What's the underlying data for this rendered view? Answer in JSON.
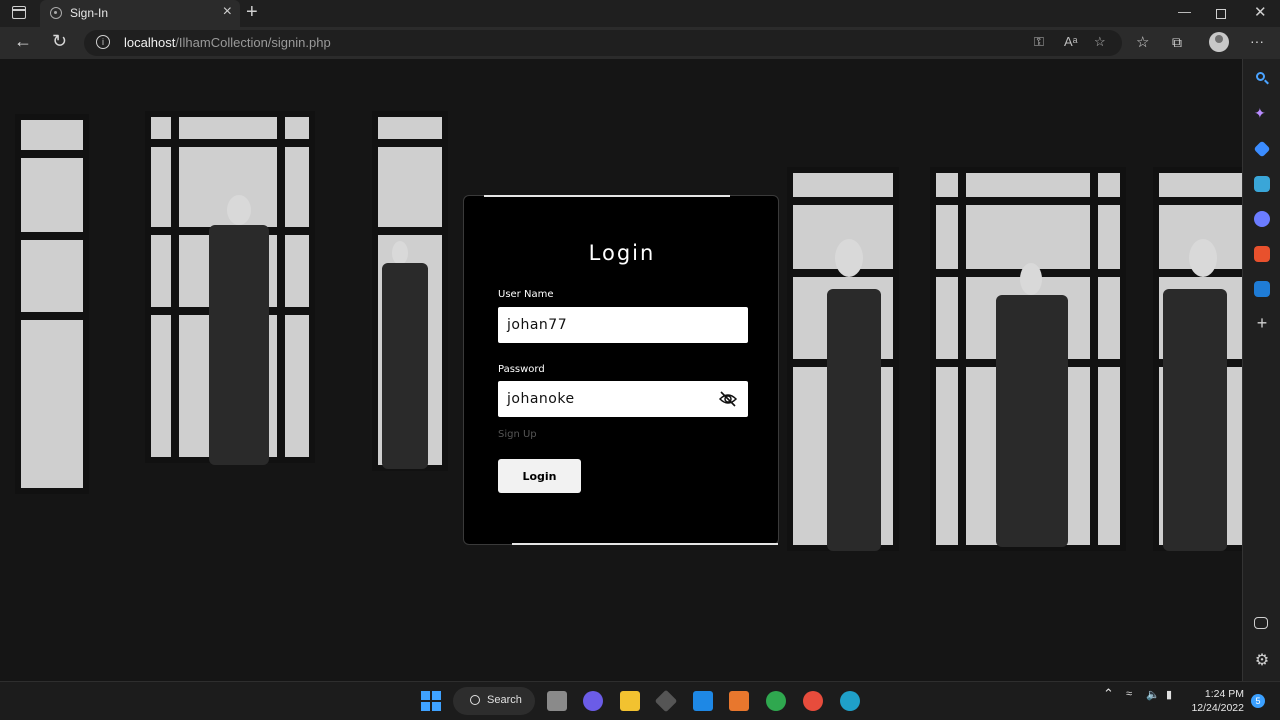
{
  "browser": {
    "tab_title": "Sign-In",
    "tab_close": "×",
    "new_tab": "+",
    "url_host": "localhost",
    "url_path": "/IlhamCollection/signin.php",
    "more": "···"
  },
  "login": {
    "title": "Login",
    "username_label": "User Name",
    "username_value": "johan77",
    "password_label": "Password",
    "password_value": "johanoke",
    "signup_link": "Sign Up",
    "login_button": "Login"
  },
  "taskbar": {
    "search_label": "Search",
    "time": "1:24 PM",
    "date": "12/24/2022",
    "notification_count": "5"
  },
  "colors": {
    "card_bg": "#000000",
    "field_bg": "#ffffff",
    "button_bg": "#f2f2f2"
  }
}
